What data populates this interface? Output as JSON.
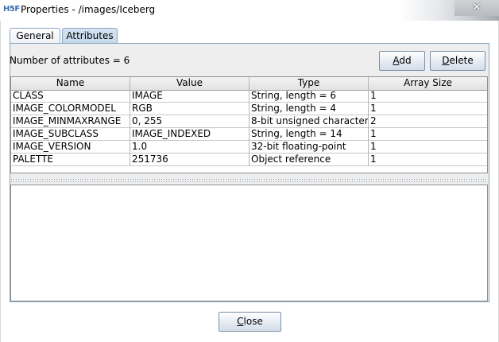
{
  "window": {
    "app_icon_text": "H5F",
    "title": "Properties - /images/Iceberg",
    "close_glyph": "✕"
  },
  "tabs": [
    {
      "label": "General",
      "selected": false
    },
    {
      "label": "Attributes",
      "selected": true
    }
  ],
  "attributes_panel": {
    "count_label": "Number of attributes = 6",
    "add_button": {
      "prefix": "",
      "mnemonic": "A",
      "suffix": "dd"
    },
    "delete_button": {
      "prefix": "",
      "mnemonic": "D",
      "suffix": "elete"
    }
  },
  "table": {
    "columns": [
      "Name",
      "Value",
      "Type",
      "Array Size"
    ],
    "rows": [
      [
        "CLASS",
        "IMAGE",
        "String, length = 6",
        "1"
      ],
      [
        "IMAGE_COLORMODEL",
        "RGB",
        "String, length = 4",
        "1"
      ],
      [
        "IMAGE_MINMAXRANGE",
        "0, 255",
        "8-bit unsigned character",
        "2"
      ],
      [
        "IMAGE_SUBCLASS",
        "IMAGE_INDEXED",
        "String, length = 14",
        "1"
      ],
      [
        "IMAGE_VERSION",
        "1.0",
        "32-bit floating-point",
        "1"
      ],
      [
        "PALETTE",
        "251736",
        "Object reference",
        "1"
      ]
    ]
  },
  "value_text": "",
  "close_button": {
    "prefix": "",
    "mnemonic": "C",
    "suffix": "lose"
  },
  "colors": {
    "tab_selected": "#c3d6ea",
    "panel_background": "#eeeeee",
    "border_accent": "#8aa5c2"
  }
}
